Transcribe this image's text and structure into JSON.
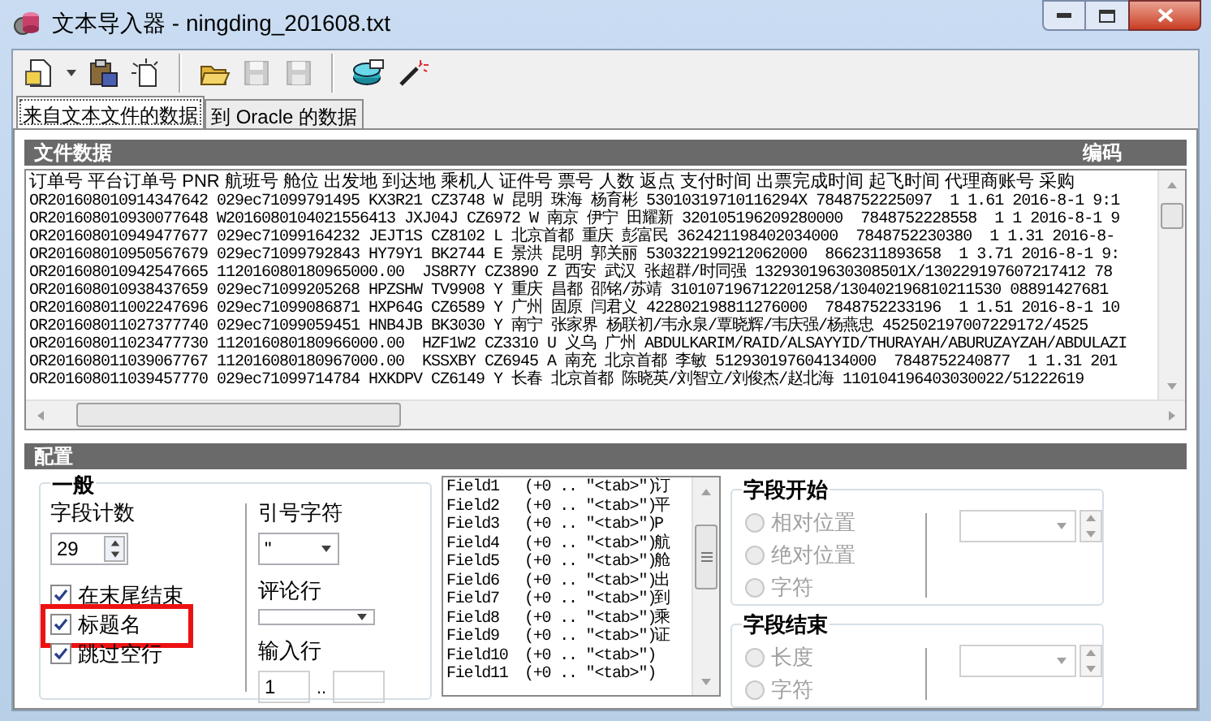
{
  "window": {
    "title": "文本导入器 - ningding_201608.txt"
  },
  "toolbar": [
    {
      "kind": "document",
      "disabled": false
    },
    {
      "kind": "caret",
      "disabled": false
    },
    {
      "kind": "clipboard",
      "disabled": false
    },
    {
      "kind": "new",
      "disabled": false
    },
    {
      "kind": "separator"
    },
    {
      "kind": "folder",
      "disabled": false
    },
    {
      "kind": "save",
      "disabled": true
    },
    {
      "kind": "save-as",
      "disabled": true
    },
    {
      "kind": "separator"
    },
    {
      "kind": "database",
      "disabled": false
    },
    {
      "kind": "wand",
      "disabled": false
    }
  ],
  "tabs": [
    {
      "label": "来自文本文件的数据",
      "selected": true
    },
    {
      "label": "到 Oracle 的数据",
      "selected": false
    }
  ],
  "file_data": {
    "title": "文件数据",
    "encoding_label": "编码",
    "header": "订单号 平台订单号 PNR 航班号 舱位 出发地 到达地 乘机人 证件号 票号 人数 返点 支付时间 出票完成时间 起飞时间 代理商账号 采购",
    "rows": [
      "OR201608010914347642 029ec71099791495 KX3R21 CZ3748 W 昆明 珠海 杨育彬 53010319710116294X 7848752225097  1 1.61 2016-8-1 9:1",
      "OR201608010930077648 W2016080104021556413 JXJ04J CZ6972 W 南京 伊宁 田耀新 320105196209280000  7848752228558  1 1 2016-8-1 9",
      "OR201608010949477677 029ec71099164232 JEJT1S CZ8102 L 北京首都 重庆 彭富民 362421198402034000  7848752230380  1 1.31 2016-8-",
      "OR201608010950567679 029ec71099792843 HY79Y1 BK2744 E 景洪 昆明 郭关丽 530322199212062000  8662311893658  1 3.71 2016-8-1 9:",
      "OR201608010942547665 112016080180965000.00  JS8R7Y CZ3890 Z 西安 武汉 张超群/时同强 13293019630308501X/130229197607217412 78",
      "OR201608010938437659 029ec71099205268 HPZSHW TV9908 Y 重庆 昌都 邵铭/苏靖 310107196712201258/130402196810211530 08891427681",
      "OR201608011002247696 029ec71099086871 HXP64G CZ6589 Y 广州 固原 闫君义 422802198811276000  7848752233196  1 1.51 2016-8-1 10",
      "OR201608011027377740 029ec71099059451 HNB4JB BK3030 Y 南宁 张家界 杨联初/韦永泉/覃晓辉/韦庆强/杨燕忠 452502197007229172/4525",
      "OR201608011023477730 112016080180966000.00  HZF1W2 CZ3310 U 义乌 广州 ABDULKARIM/RAID/ALSAYYID/THURAYAH/ABURUZAYZAH/ABDULAZI",
      "OR201608011039067767 112016080180967000.00  KSSXBY CZ6945 A 南充 北京首都 李敏 512930197604134000  7848752240877  1 1.31 201",
      "OR201608011039457770 029ec71099714784 HXKDPV CZ6149 Y 长春 北京首都 陈晓英/刘智立/刘俊杰/赵北海 110104196403030022/51222619"
    ]
  },
  "config": {
    "title": "配置",
    "general": {
      "title": "一般",
      "field_count_label": "字段计数",
      "field_count_value": "29",
      "checkboxes": [
        {
          "label": "在末尾结束",
          "checked": true,
          "highlighted": false
        },
        {
          "label": "标题名",
          "checked": true,
          "highlighted": true
        },
        {
          "label": "跳过空行",
          "checked": true,
          "highlighted": false
        }
      ],
      "quote_label": "引号字符",
      "quote_value": "\"",
      "comment_label": "评论行",
      "input_rows_label": "输入行",
      "input_row_from": "1",
      "range_separator": ".."
    },
    "fields": [
      {
        "name": "Field1",
        "range": "(+0 .. \"<tab>\")",
        "preview": "订"
      },
      {
        "name": "Field2",
        "range": "(+0 .. \"<tab>\")",
        "preview": "平"
      },
      {
        "name": "Field3",
        "range": "(+0 .. \"<tab>\")",
        "preview": "P"
      },
      {
        "name": "Field4",
        "range": "(+0 .. \"<tab>\")",
        "preview": "航"
      },
      {
        "name": "Field5",
        "range": "(+0 .. \"<tab>\")",
        "preview": "舱"
      },
      {
        "name": "Field6",
        "range": "(+0 .. \"<tab>\")",
        "preview": "出"
      },
      {
        "name": "Field7",
        "range": "(+0 .. \"<tab>\")",
        "preview": "到"
      },
      {
        "name": "Field8",
        "range": "(+0 .. \"<tab>\")",
        "preview": "乘"
      },
      {
        "name": "Field9",
        "range": "(+0 .. \"<tab>\")",
        "preview": "证"
      },
      {
        "name": "Field10",
        "range": "(+0 .. \"<tab>\")"
      },
      {
        "name": "Field11",
        "range": "(+0 .. \"<tab>\")"
      }
    ],
    "field_start": {
      "title": "字段开始",
      "options": [
        {
          "label": "相对位置",
          "selected": false,
          "disabled": true
        },
        {
          "label": "绝对位置",
          "selected": false,
          "disabled": true
        },
        {
          "label": "字符",
          "selected": false,
          "disabled": true
        }
      ]
    },
    "field_end": {
      "title": "字段结束",
      "options": [
        {
          "label": "长度",
          "selected": false,
          "disabled": true
        },
        {
          "label": "字符",
          "selected": false,
          "disabled": true
        }
      ]
    }
  }
}
